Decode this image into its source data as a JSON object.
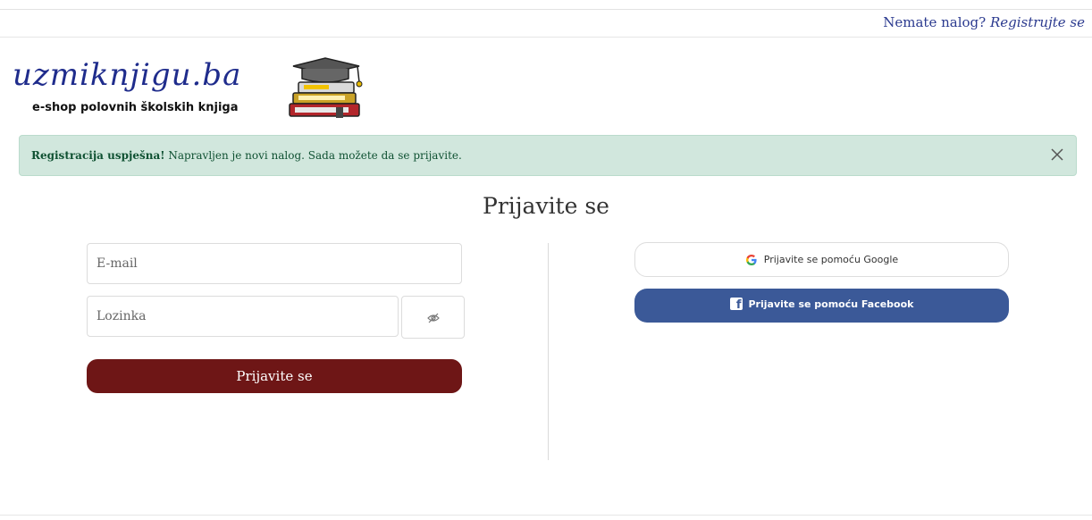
{
  "topbar": {
    "question": "Nemate nalog?",
    "register_link": "Registrujte se"
  },
  "logo": {
    "brand": "uzmiknjigu.ba",
    "tagline": "e-shop polovnih školskih knjiga"
  },
  "alert": {
    "strong": "Registracija uspješna!",
    "message": "Napravljen je novi nalog. Sada možete da se prijavite."
  },
  "page_title": "Prijavite se",
  "form": {
    "email_placeholder": "E-mail",
    "password_placeholder": "Lozinka",
    "submit_label": "Prijavite se"
  },
  "social": {
    "google_label": "Prijavite se pomoću Google",
    "facebook_label": "Prijavite se pomoću Facebook"
  },
  "colors": {
    "brand_blue": "#1f2c8c",
    "alert_bg": "#d1e7dd",
    "login_button": "#6e1616",
    "facebook_blue": "#3b5998"
  }
}
